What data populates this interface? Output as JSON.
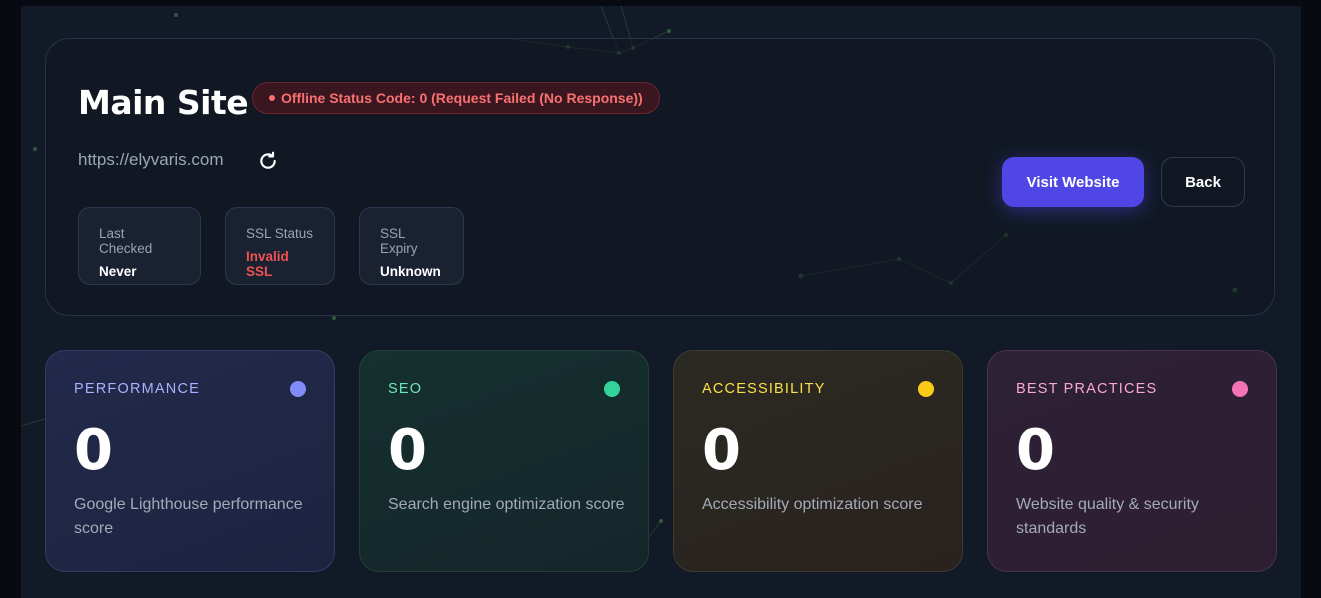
{
  "site": {
    "title": "Main Site",
    "status_badge": "Offline Status Code: 0 (Request Failed (No Response))",
    "url": "https://elyvaris.com"
  },
  "info": [
    {
      "label": "Last Checked",
      "value": "Never"
    },
    {
      "label": "SSL Status",
      "value": "Invalid SSL"
    },
    {
      "label": "SSL Expiry",
      "value": "Unknown"
    }
  ],
  "actions": {
    "visit_label": "Visit Website",
    "back_label": "Back"
  },
  "metrics": [
    {
      "title": "PERFORMANCE",
      "value": "0",
      "description": "Google Lighthouse performance score",
      "color": "#818cf8"
    },
    {
      "title": "SEO",
      "value": "0",
      "description": "Search engine optimization score",
      "color": "#34d399"
    },
    {
      "title": "ACCESSIBILITY",
      "value": "0",
      "description": "Accessibility optimization score",
      "color": "#facc15"
    },
    {
      "title": "BEST PRACTICES",
      "value": "0",
      "description": "Website quality & security standards",
      "color": "#f472b6"
    }
  ],
  "colors": {
    "accent": "#4f46e5",
    "error": "#f87171"
  },
  "icons": {
    "refresh": "refresh-icon"
  }
}
